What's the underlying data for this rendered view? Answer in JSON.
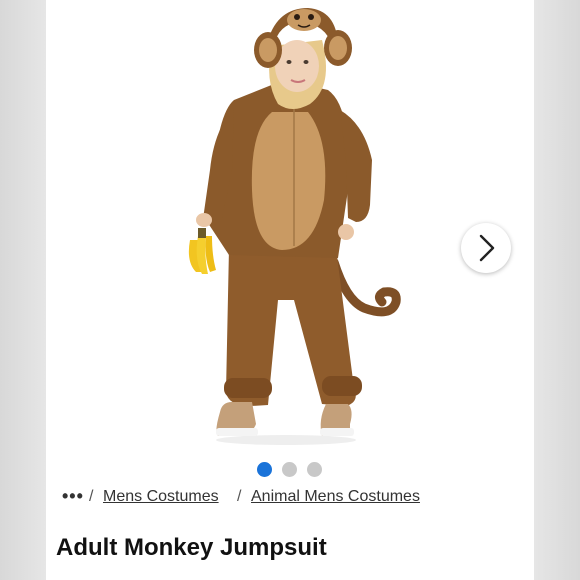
{
  "product": {
    "title": "Adult Monkey Jumpsuit",
    "image_alt": "Adult Monkey Jumpsuit",
    "image_count": 3,
    "active_image": 1
  },
  "breadcrumb": {
    "ellipsis": "•••",
    "separator": "/",
    "items": [
      "Mens Costumes",
      "Animal Mens Costumes"
    ]
  },
  "carousel": {
    "next_icon": "chevron-right-icon"
  },
  "colors": {
    "active_dot": "#1a73d9",
    "inactive_dot": "#c8c8c8",
    "costume_brown": "#8b5a2b",
    "costume_tan": "#c99a63",
    "banana": "#f2c521"
  }
}
